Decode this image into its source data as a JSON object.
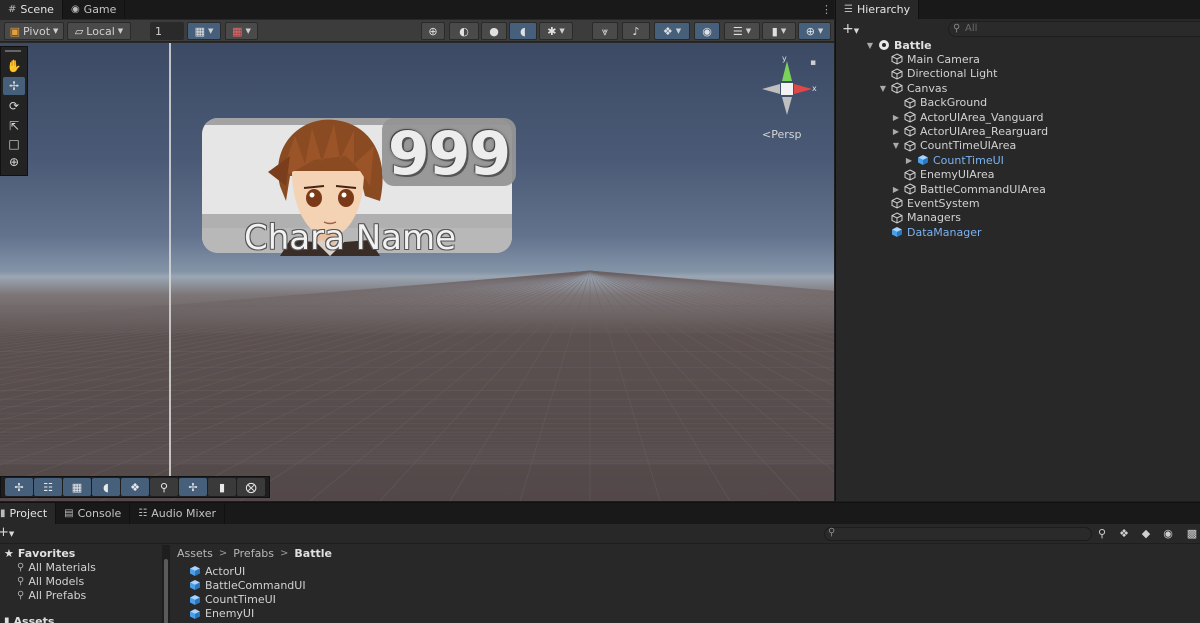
{
  "scene_tabs": [
    {
      "label": "Scene",
      "icon": "scene-grid-icon",
      "active": true
    },
    {
      "label": "Game",
      "icon": "gamepad-icon",
      "active": false
    }
  ],
  "scene_toolbar": {
    "pivot_label": "Pivot",
    "space_label": "Local",
    "grid_snap_value": "1"
  },
  "viewport": {
    "persp_label": "Persp",
    "gizmo": {
      "x_label": "x",
      "y_label": "y"
    }
  },
  "ui_card": {
    "count_value": "999",
    "chara_name": "Chara Name"
  },
  "hierarchy": {
    "tab_label": "Hierarchy",
    "search_placeholder": "All",
    "items": [
      {
        "label": "Battle",
        "depth": 0,
        "expanded": true,
        "type": "scene"
      },
      {
        "label": "Main Camera",
        "depth": 1,
        "type": "object"
      },
      {
        "label": "Directional Light",
        "depth": 1,
        "type": "object"
      },
      {
        "label": "Canvas",
        "depth": 1,
        "expanded": true,
        "type": "object"
      },
      {
        "label": "BackGround",
        "depth": 2,
        "type": "object"
      },
      {
        "label": "ActorUIArea_Vanguard",
        "depth": 2,
        "collapsed": true,
        "type": "object"
      },
      {
        "label": "ActorUIArea_Rearguard",
        "depth": 2,
        "collapsed": true,
        "type": "object"
      },
      {
        "label": "CountTimeUIArea",
        "depth": 2,
        "expanded": true,
        "type": "object"
      },
      {
        "label": "CountTimeUI",
        "depth": 3,
        "collapsed": true,
        "type": "prefab"
      },
      {
        "label": "EnemyUIArea",
        "depth": 2,
        "type": "object"
      },
      {
        "label": "BattleCommandUIArea",
        "depth": 2,
        "collapsed": true,
        "type": "object"
      },
      {
        "label": "EventSystem",
        "depth": 1,
        "type": "object"
      },
      {
        "label": "Managers",
        "depth": 1,
        "type": "object"
      },
      {
        "label": "DataManager",
        "depth": 1,
        "type": "prefab"
      }
    ]
  },
  "project": {
    "tabs": [
      {
        "label": "Project",
        "icon": "folder-icon",
        "active": true
      },
      {
        "label": "Console",
        "icon": "console-icon",
        "active": false
      },
      {
        "label": "Audio Mixer",
        "icon": "audio-mixer-icon",
        "active": false
      }
    ],
    "favorites_label": "Favorites",
    "favorites": [
      "All Materials",
      "All Models",
      "All Prefabs"
    ],
    "assets_label": "Assets",
    "breadcrumb": [
      "Assets",
      "Prefabs",
      "Battle"
    ],
    "assets": [
      "ActorUI",
      "BattleCommandUI",
      "CountTimeUI",
      "EnemyUI"
    ]
  },
  "colors": {
    "prefab_blue": "#7cb2f0",
    "active_tool": "#46607c",
    "panel_bg": "#282828"
  }
}
